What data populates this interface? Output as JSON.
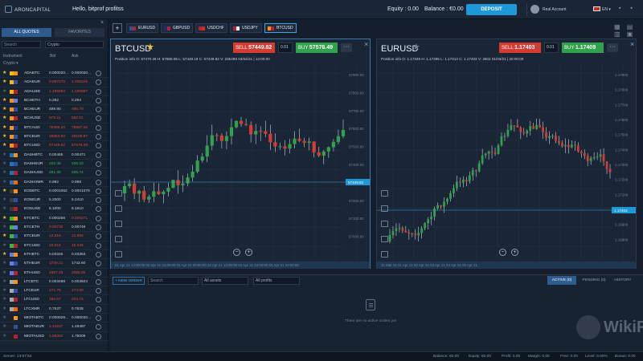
{
  "header": {
    "brand": "ARONCAPITAL",
    "greeting": "Hello, bitprof profitss",
    "equity": "Equity : 0.00",
    "balance": "Balance : €0.00",
    "deposit": "DEPOSIT",
    "account": "Real Account",
    "lang": "EN",
    "window_controls": "▪ ▪"
  },
  "quotes": {
    "tab_all": "ALL QUOTES",
    "tab_fav": "FAVORITES",
    "search_placeholder": "Search",
    "filter": "Crypto",
    "col_instrument": "Instrument",
    "col_bid": "Bid",
    "col_ask": "Ask",
    "category": "Crypto ▾",
    "rows": [
      {
        "fav": true,
        "name": "ADABTC",
        "bid": "0.000020...",
        "ask": "0.000020...",
        "bc": "#c8d3e0",
        "ac": "#c8d3e0",
        "f1": "#f0b90b",
        "f2": "#f7931a"
      },
      {
        "fav": true,
        "name": "ADAEUR",
        "bid": "0.997270",
        "ask": "1.005345",
        "bc": "#e0463c",
        "ac": "#e0463c",
        "f1": "#f0b90b",
        "f2": "#2f4fa8"
      },
      {
        "fav": false,
        "name": "ADAUSD",
        "bid": "1.165063",
        "ask": "1.190367",
        "bc": "#e0463c",
        "ac": "#e0463c",
        "f1": "#f0b90b",
        "f2": "#b22234"
      },
      {
        "fav": true,
        "name": "BCHETH",
        "bid": "0.282",
        "ask": "0.294",
        "bc": "#c8d3e0",
        "ac": "#c8d3e0",
        "f1": "#f7931a",
        "f2": "#627eea"
      },
      {
        "fav": true,
        "name": "BCHEUR",
        "bid": "489.90",
        "ask": "495.79",
        "bc": "#c8d3e0",
        "ac": "#e0463c",
        "f1": "#f7931a",
        "f2": "#2f4fa8"
      },
      {
        "fav": true,
        "name": "BCHUSD",
        "bid": "579.21",
        "ask": "582.51",
        "bc": "#e0463c",
        "ac": "#e0463c",
        "f1": "#f7931a",
        "f2": "#b22234"
      },
      {
        "fav": true,
        "name": "BTCAUD",
        "bid": "75406.20",
        "ask": "75567.25",
        "bc": "#e0463c",
        "ac": "#e0463c",
        "f1": "#f7931a",
        "f2": "#1d3c8f"
      },
      {
        "fav": true,
        "name": "BTCEUR",
        "bid": "48953.60",
        "ask": "49105.97",
        "bc": "#e0463c",
        "ac": "#e0463c",
        "f1": "#f7931a",
        "f2": "#2f4fa8"
      },
      {
        "fav": true,
        "name": "BTCUSD",
        "bid": "57449.82",
        "ask": "57578.49",
        "bc": "#e0463c",
        "ac": "#e0463c",
        "f1": "#f7931a",
        "f2": "#b22234"
      },
      {
        "fav": false,
        "name": "DASHBTC",
        "bid": "0.00465",
        "ask": "0.00471",
        "bc": "#c8d3e0",
        "ac": "#c8d3e0",
        "f1": "#1c75bc",
        "f2": "#f7931a"
      },
      {
        "fav": false,
        "name": "DASHEUR",
        "bid": "222.46",
        "ask": "226.33",
        "bc": "#2fbf5a",
        "ac": "#2fbf5a",
        "f1": "#1c75bc",
        "f2": "#2f4fa8"
      },
      {
        "fav": false,
        "name": "DASHUSD",
        "bid": "261.30",
        "ask": "265.74",
        "bc": "#2fbf5a",
        "ac": "#2fbf5a",
        "f1": "#1c75bc",
        "f2": "#b22234"
      },
      {
        "fav": false,
        "name": "DASHXMR",
        "bid": "0.992",
        "ask": "0.998",
        "bc": "#c8d3e0",
        "ac": "#c8d3e0",
        "f1": "#1c75bc",
        "f2": "#ff6600"
      },
      {
        "fav": true,
        "name": "EOSBTC",
        "bid": "0.0001062",
        "ask": "0.0001079",
        "bc": "#c8d3e0",
        "ac": "#c8d3e0",
        "f1": "#3b3b3b",
        "f2": "#f7931a"
      },
      {
        "fav": false,
        "name": "EOSEUR",
        "bid": "5.2000",
        "ask": "5.2410",
        "bc": "#c8d3e0",
        "ac": "#c8d3e0",
        "f1": "#3b3b3b",
        "f2": "#2f4fa8"
      },
      {
        "fav": false,
        "name": "EOSUSD",
        "bid": "6.1000",
        "ask": "6.1610",
        "bc": "#c8d3e0",
        "ac": "#c8d3e0",
        "f1": "#3b3b3b",
        "f2": "#b22234"
      },
      {
        "fav": true,
        "name": "ETCBTC",
        "bid": "0.000258",
        "ask": "0.000271",
        "bc": "#c8d3e0",
        "ac": "#e0463c",
        "f1": "#3ab83a",
        "f2": "#f7931a"
      },
      {
        "fav": false,
        "name": "ETCETH",
        "bid": "0.00738",
        "ask": "0.00746",
        "bc": "#e0463c",
        "ac": "#c8d3e0",
        "f1": "#3ab83a",
        "f2": "#627eea"
      },
      {
        "fav": true,
        "name": "ETCEUR",
        "bid": "12.616",
        "ask": "12.894",
        "bc": "#e0463c",
        "ac": "#e0463c",
        "f1": "#3ab83a",
        "f2": "#2f4fa8"
      },
      {
        "fav": false,
        "name": "ETCUSD",
        "bid": "15.015",
        "ask": "15.346",
        "bc": "#e0463c",
        "ac": "#e0463c",
        "f1": "#3ab83a",
        "f2": "#b22234"
      },
      {
        "fav": true,
        "name": "ETHBTC",
        "bid": "0.03346",
        "ask": "0.03353",
        "bc": "#c8d3e0",
        "ac": "#c8d3e0",
        "f1": "#627eea",
        "f2": "#f7931a"
      },
      {
        "fav": false,
        "name": "ETHEUR",
        "bid": "1730.21",
        "ask": "1742.60",
        "bc": "#e0463c",
        "ac": "#c8d3e0",
        "f1": "#627eea",
        "f2": "#2f4fa8"
      },
      {
        "fav": false,
        "name": "ETHUSD",
        "bid": "2057.19",
        "ask": "2065.95",
        "bc": "#e0463c",
        "ac": "#e0463c",
        "f1": "#627eea",
        "f2": "#b22234"
      },
      {
        "fav": false,
        "name": "LTCBTC",
        "bid": "0.003498",
        "ask": "0.003504",
        "bc": "#c8d3e0",
        "ac": "#c8d3e0",
        "f1": "#a6a9aa",
        "f2": "#f7931a"
      },
      {
        "fav": false,
        "name": "LTCEUR",
        "bid": "171.79",
        "ask": "174.00",
        "bc": "#e0463c",
        "ac": "#e0463c",
        "f1": "#a6a9aa",
        "f2": "#2f4fa8"
      },
      {
        "fav": false,
        "name": "LTCUSD",
        "bid": "182.57",
        "ask": "204.74",
        "bc": "#e0463c",
        "ac": "#e0463c",
        "f1": "#a6a9aa",
        "f2": "#b22234"
      },
      {
        "fav": false,
        "name": "LTCXMR",
        "bid": "0.7637",
        "ask": "0.7638",
        "bc": "#c8d3e0",
        "ac": "#c8d3e0",
        "f1": "#a6a9aa",
        "f2": "#ff6600"
      },
      {
        "fav": false,
        "name": "MIOTABTC",
        "bid": "0.000029...",
        "ask": "0.000030...",
        "bc": "#c8d3e0",
        "ac": "#c8d3e0",
        "f1": "#222222",
        "f2": "#f7931a"
      },
      {
        "fav": false,
        "name": "MIOTAEUR",
        "bid": "1.44237",
        "ask": "1.49487",
        "bc": "#e0463c",
        "ac": "#c8d3e0",
        "f1": "#222222",
        "f2": "#2f4fa8"
      },
      {
        "fav": false,
        "name": "MIOTAUSD",
        "bid": "1.69362",
        "ask": "1.75009",
        "bc": "#e0463c",
        "ac": "#c8d3e0",
        "f1": "#222222",
        "f2": "#b22234"
      }
    ]
  },
  "tabs": [
    {
      "label": "EURUSD",
      "f1": "#2f4fa8",
      "f2": "#b22234",
      "active": false
    },
    {
      "label": "GBPUSD",
      "f1": "#1d2f6e",
      "f2": "#b22234",
      "active": false
    },
    {
      "label": "USDCHF",
      "f1": "#b22234",
      "f2": "#d52b1e",
      "active": false
    },
    {
      "label": "USDJPY",
      "f1": "#b22234",
      "f2": "#f1f1f1",
      "active": false
    },
    {
      "label": "BTCUSD",
      "f1": "#f7931a",
      "f2": "#b22234",
      "active": true
    }
  ],
  "tab_grid_icons": "▦ ▤ ▥ ▣",
  "panels": [
    {
      "symbol": "BTCUSD",
      "sell": "57449.82",
      "buy": "57578.49",
      "lot": "0.01",
      "position": "Position info",
      "o": "57470.46",
      "h": "57885.95",
      "l": "57448.19",
      "c": "57449.82",
      "v": "235499",
      "time": "04/04/21 | 14:00:00",
      "current_price": "57449.82",
      "yticks": [
        "57900.00",
        "57800.00",
        "57700.00",
        "57600.00",
        "57500.00",
        "57400.00",
        "57300.00",
        "57200.00",
        "57100.00",
        "57000.00"
      ],
      "xaxis": "01 Apr 21 12:00:00   02 Apr 21 04:00:00   02 Apr 21 20:00:00   03 Apr 21 12:00:00   04 Apr 21 04:00:00   04 Apr 21 20:00:00"
    },
    {
      "symbol": "EURUSD",
      "sell": "1.17403",
      "buy": "1.17409",
      "lot": "0.01",
      "position": "Position info",
      "o": "1.17345",
      "h": "1.17395",
      "l": "1.17313",
      "c": "1.17403",
      "v": "2602",
      "time": "01/03/21 | 20:00:00",
      "current_price": "1.17403",
      "yticks": [
        "1.17900",
        "1.17800",
        "1.17700",
        "1.17600",
        "1.17500",
        "1.17400",
        "1.17300",
        "1.17200",
        "1.17100",
        "1.17000",
        "1.16900",
        "1.16800"
      ],
      "xaxis": "31 Mar 21   01 Apr 21   02 Apr 21   03 Apr 21   04 Apr 21   05 Apr 21"
    }
  ],
  "orders": {
    "new_order": "+ NEW ORDER",
    "search_placeholder": "Search",
    "assets": "All assets",
    "profits": "All profits",
    "tab_active": "ACTIVE (0)",
    "tab_pending": "PENDING (0)",
    "tab_history": "HISTORY",
    "empty": "There are no active orders yet",
    "watermark": "WikiFX"
  },
  "status": {
    "server": "Server: 13:57:54",
    "balance": "Balance: €0.00",
    "equity": "Equity: €0.00",
    "profit": "Profit: 0.00",
    "margin": "Margin: 0.00",
    "free": "Free: 0.00",
    "level": "Level: 0.00%",
    "bonus": "Bonus: 0.00"
  },
  "colors": {
    "bull": "#2fa24a",
    "bear": "#d63b32",
    "accent": "#1e98d8"
  }
}
